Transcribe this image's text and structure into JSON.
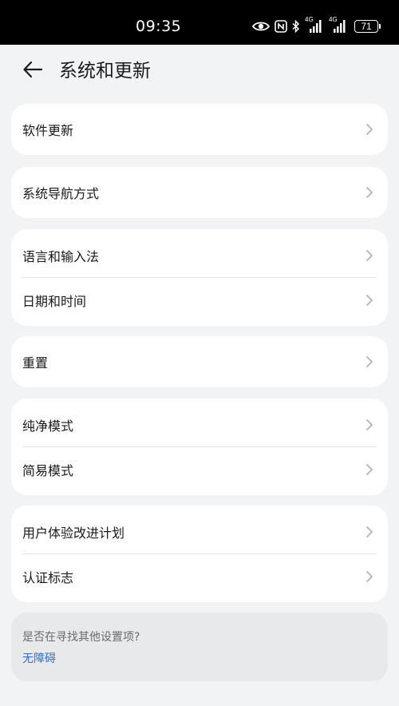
{
  "status_bar": {
    "time": "09:35",
    "network_label_1": "4G",
    "network_label_2": "4G",
    "battery_level": "71",
    "icons": [
      "eye-icon",
      "nfc-icon",
      "bluetooth-icon",
      "signal-icon",
      "signal-icon",
      "battery-icon"
    ]
  },
  "header": {
    "back_icon": "arrow-left-icon",
    "title": "系统和更新"
  },
  "groups": [
    {
      "items": [
        {
          "label": "软件更新"
        }
      ]
    },
    {
      "items": [
        {
          "label": "系统导航方式"
        }
      ]
    },
    {
      "items": [
        {
          "label": "语言和输入法"
        },
        {
          "label": "日期和时间"
        }
      ]
    },
    {
      "items": [
        {
          "label": "重置"
        }
      ]
    },
    {
      "items": [
        {
          "label": "纯净模式"
        },
        {
          "label": "简易模式"
        }
      ]
    },
    {
      "items": [
        {
          "label": "用户体验改进计划"
        },
        {
          "label": "认证标志"
        }
      ]
    }
  ],
  "tip": {
    "question": "是否在寻找其他设置项?",
    "link": "无障碍"
  },
  "colors": {
    "background": "#f1f3f5",
    "card": "#ffffff",
    "link": "#2f6fd6",
    "chevron": "#b3b3b3"
  }
}
